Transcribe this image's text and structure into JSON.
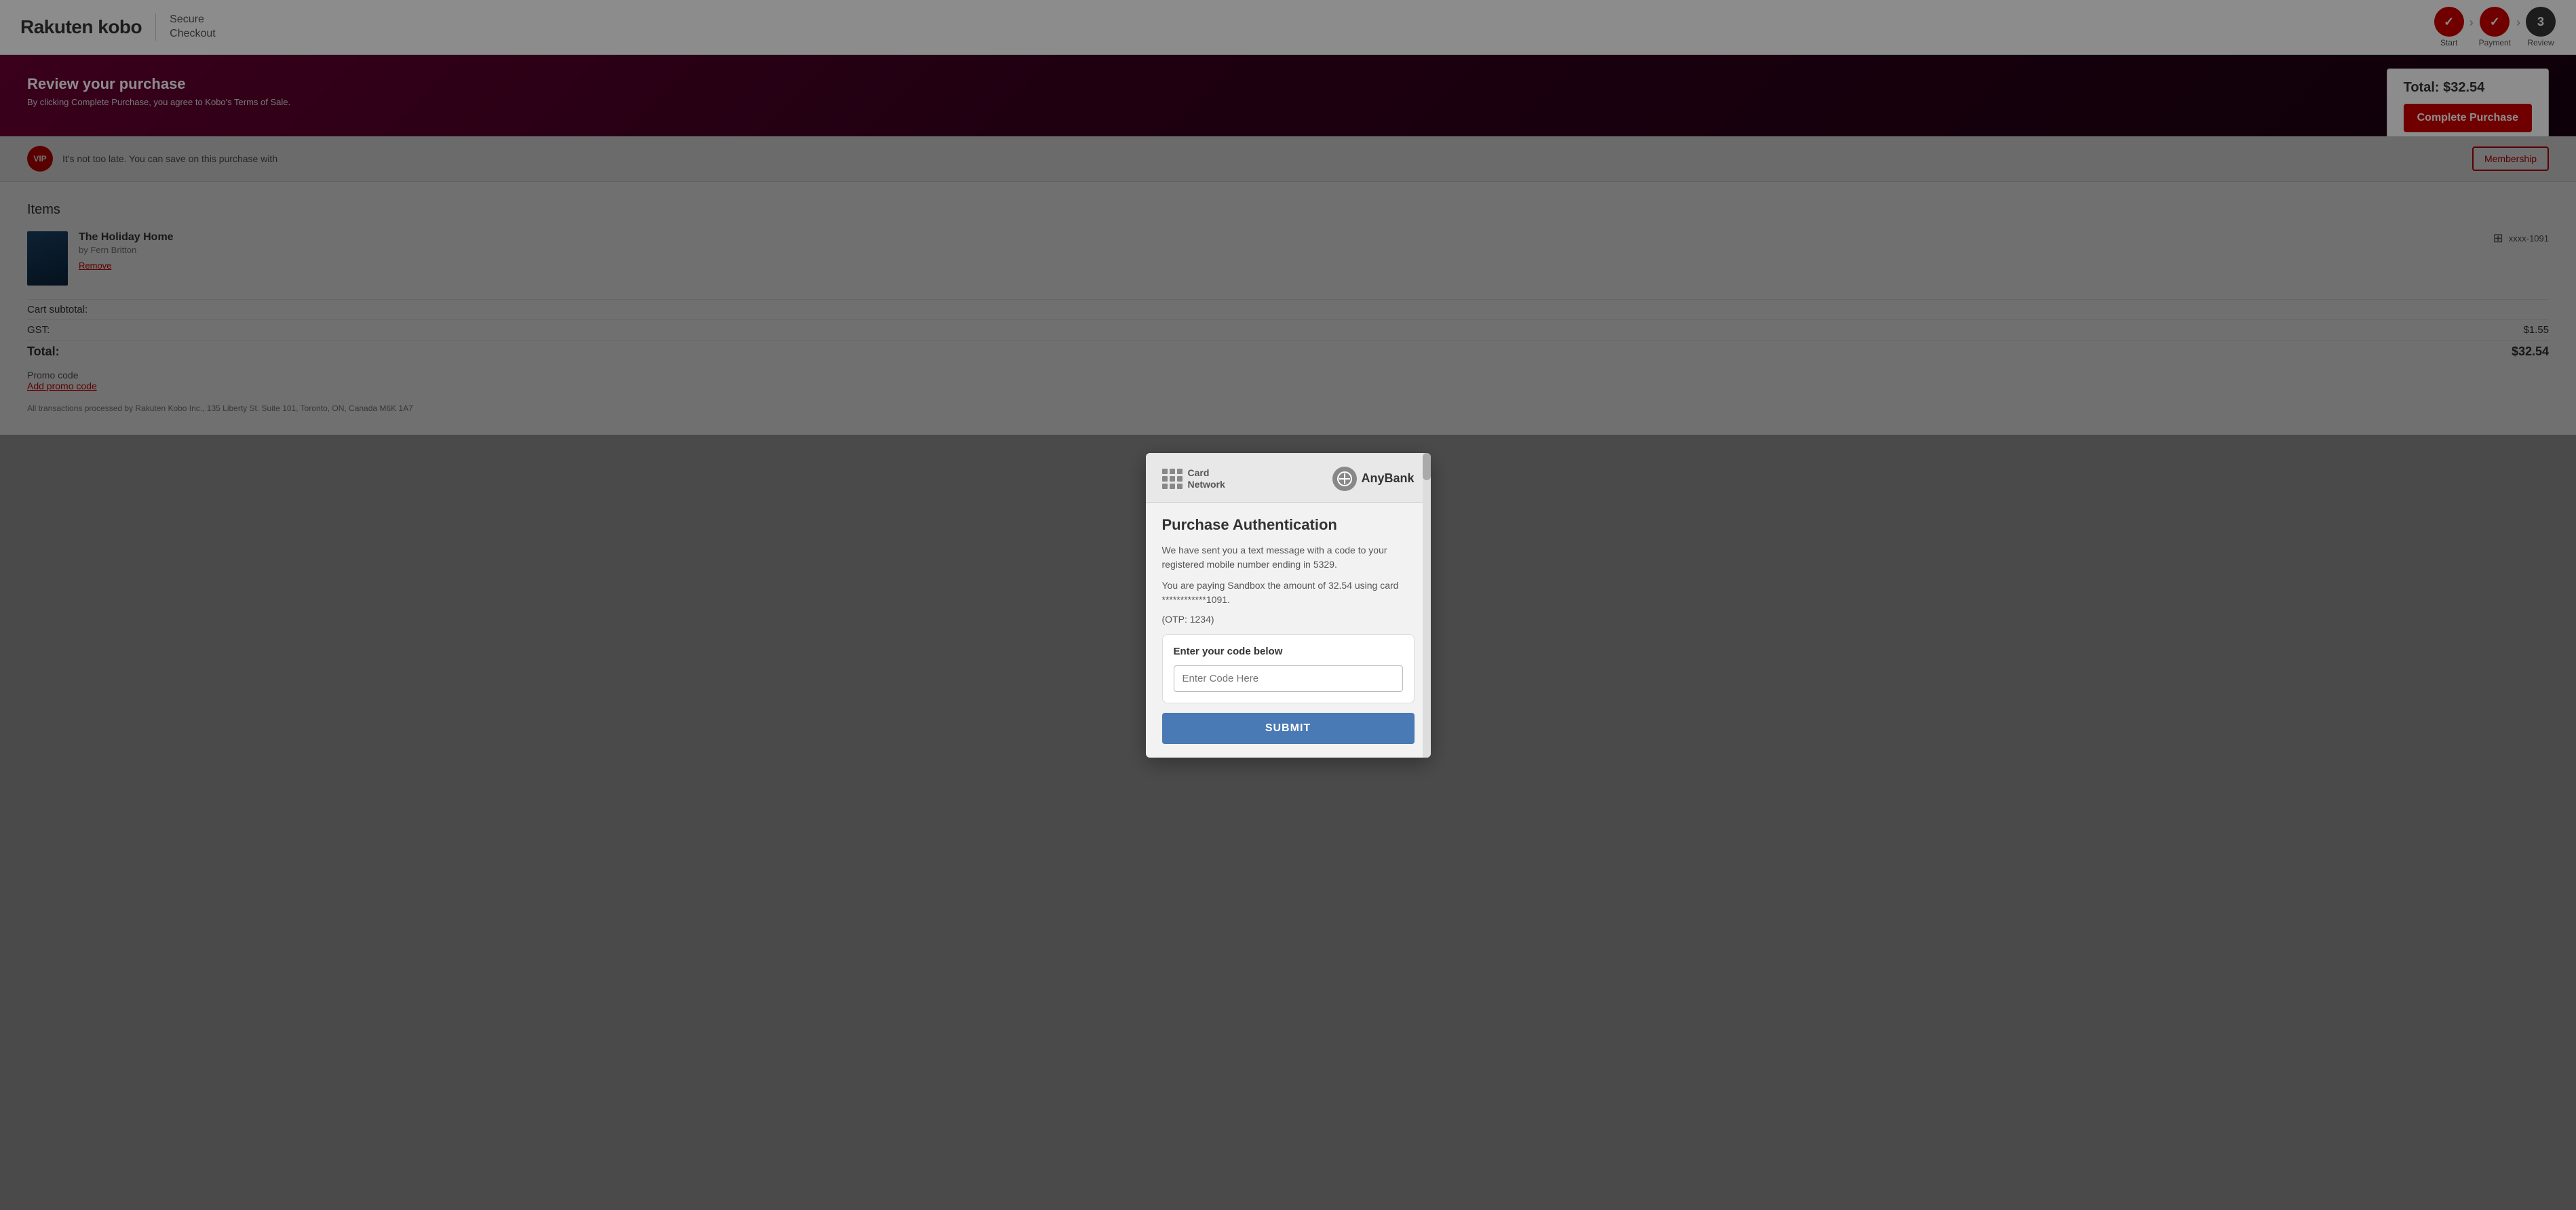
{
  "header": {
    "logo_text": "Rakuten kobo",
    "logo_part1": "Rakuten ",
    "logo_part2": "kobo",
    "secure_checkout_line1": "Secure",
    "secure_checkout_line2": "Checkout",
    "steps": [
      {
        "id": "start",
        "label": "Start",
        "state": "done"
      },
      {
        "id": "payment",
        "label": "Payment",
        "state": "done"
      },
      {
        "id": "review",
        "label": "Review",
        "state": "active",
        "number": "3"
      }
    ]
  },
  "review_banner": {
    "title": "Review your purchase",
    "subtitle": "By clicking Complete Purchase, you agree to Kobo's Terms of Sale.",
    "total_label": "Total: $32.54",
    "complete_button": "Complete Purchase"
  },
  "vip": {
    "badge": "VIP",
    "text": "It's not too late. You can save on this purchase with",
    "button": "Membership"
  },
  "items": {
    "section_title": "Items",
    "item": {
      "title": "The Holiday Home",
      "author": "by Fern Britton",
      "remove_label": "Remove",
      "card_info": "xxxx-1091"
    }
  },
  "pricing": {
    "subtotal_label": "Cart subtotal:",
    "subtotal_value": "",
    "gst_label": "GST:",
    "gst_value": "$1.55",
    "total_label": "Total:",
    "total_value": "$32.54"
  },
  "promo": {
    "label": "Promo code",
    "link": "Add promo code"
  },
  "footer_note": "All transactions processed by Rakuten Kobo Inc., 135 Liberty St. Suite 101, Toronto, ON, Canada M6K 1A7",
  "modal": {
    "card_network_label_line1": "Card",
    "card_network_label_line2": "Network",
    "anybank_label": "AnyBank",
    "title": "Purchase Authentication",
    "desc1": "We have sent you a text message with a code to your registered mobile number ending in 5329.",
    "desc2": "You are paying Sandbox the amount of 32.54 using card ************1091.",
    "otp_hint": "(OTP: 1234)",
    "code_section_label": "Enter your code below",
    "code_input_placeholder": "Enter Code Here",
    "submit_button": "SUBMIT"
  }
}
